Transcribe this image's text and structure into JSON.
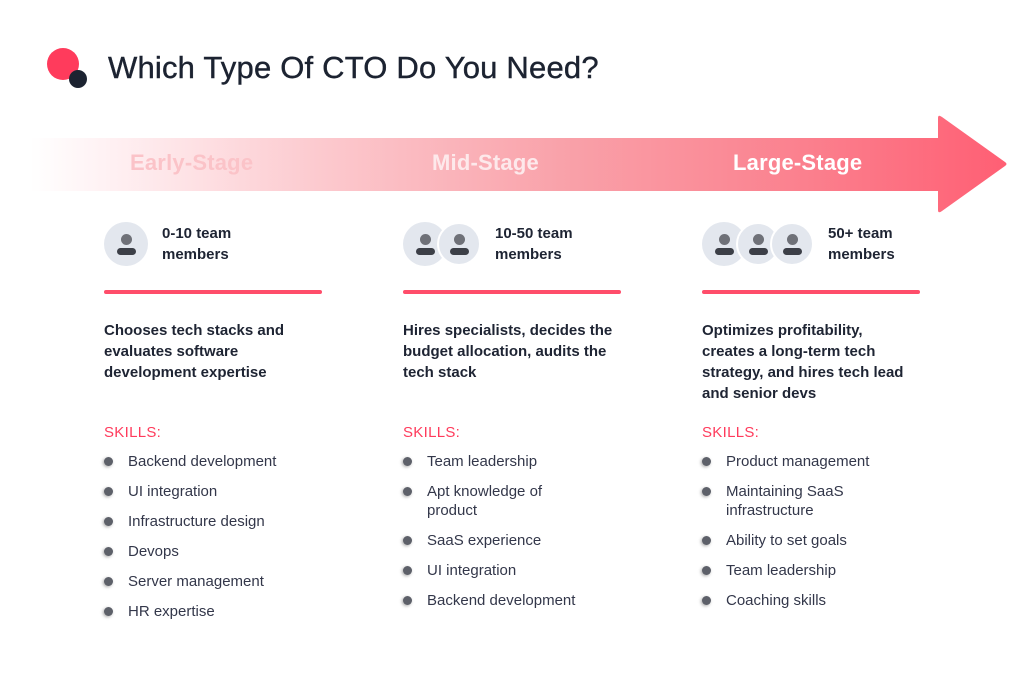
{
  "header": {
    "title": "Which Type Of CTO Do You Need?"
  },
  "colors": {
    "accent": "#ff3b5c",
    "dark": "#1c2331",
    "arrow_end": "#ff5f74",
    "avatar_bg": "#e3e7ee"
  },
  "arrow": {
    "stages": [
      "Early-Stage",
      "Mid-Stage",
      "Large-Stage"
    ]
  },
  "columns": [
    {
      "stage": "Early-Stage",
      "avatar_count": 1,
      "team_size": "0-10 team\nmembers",
      "description": "Chooses tech stacks and evaluates software development expertise",
      "skills_label": "SKILLS:",
      "skills": [
        "Backend development",
        "UI integration",
        "Infrastructure design",
        "Devops",
        "Server management",
        "HR expertise"
      ]
    },
    {
      "stage": "Mid-Stage",
      "avatar_count": 2,
      "team_size": "10-50 team\nmembers",
      "description": "Hires specialists, decides the budget allocation, audits the tech stack",
      "skills_label": "SKILLS:",
      "skills": [
        "Team leadership",
        "Apt knowledge of product",
        "SaaS experience",
        "UI integration",
        "Backend development"
      ]
    },
    {
      "stage": "Large-Stage",
      "avatar_count": 3,
      "team_size": "50+ team\nmembers",
      "description": "Optimizes profitability, creates a long-term tech strategy, and hires tech lead and senior devs",
      "skills_label": "SKILLS:",
      "skills": [
        "Product management",
        "Maintaining SaaS infrastructure",
        "Ability to set goals",
        "Team leadership",
        "Coaching skills"
      ]
    }
  ]
}
